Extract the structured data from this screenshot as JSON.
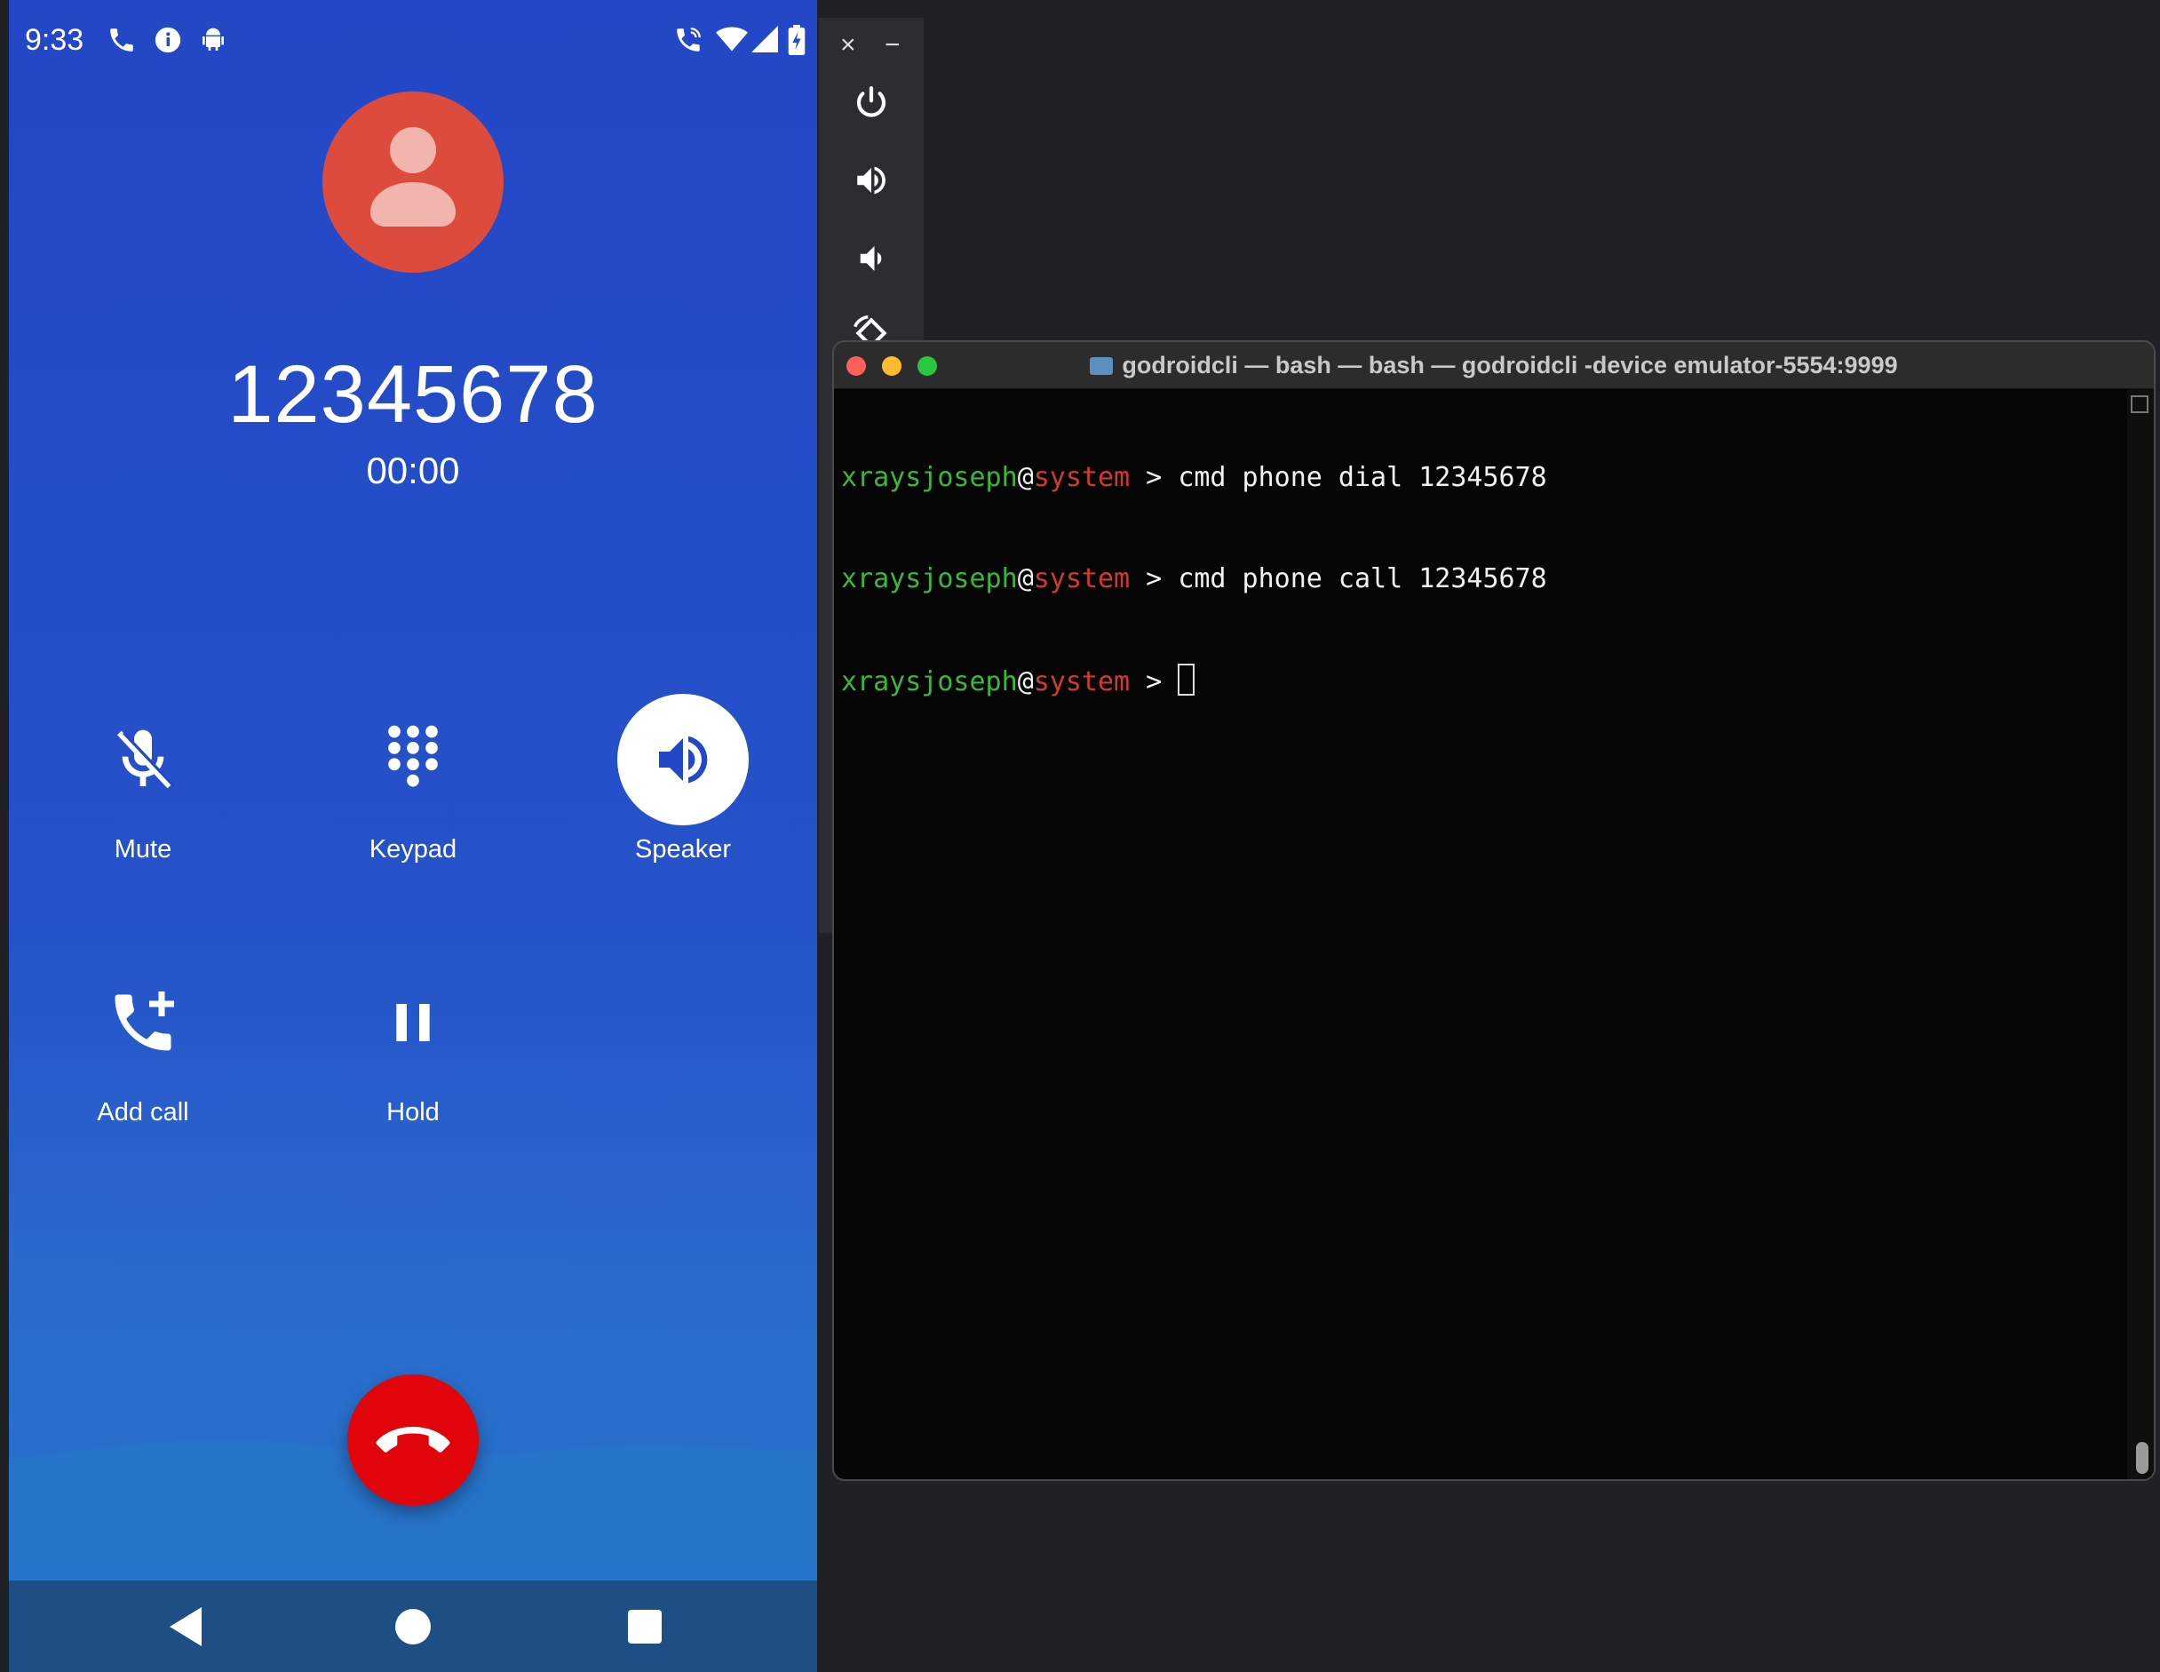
{
  "status_bar": {
    "time": "9:33",
    "left_icons": [
      "phone-call-icon",
      "info-icon",
      "android-icon"
    ],
    "right_icons": [
      "wifi-calling-icon",
      "wifi-icon",
      "cell-signal-icon",
      "battery-charging-icon"
    ]
  },
  "call": {
    "number": "12345678",
    "timer": "00:00"
  },
  "controls": {
    "mute": "Mute",
    "keypad": "Keypad",
    "speaker": "Speaker",
    "add_call": "Add call",
    "hold": "Hold"
  },
  "colors": {
    "avatar": "#dd4b3d",
    "end_call": "#e0040b",
    "phone_background": "#2347c6",
    "terminal_user": "#3bb83b",
    "terminal_host": "#d13a2d"
  },
  "toolbar": {
    "close": "×",
    "minimize": "−"
  },
  "terminal": {
    "title": "godroidcli — bash — bash — godroidcli -device emulator-5554:9999",
    "prompt": {
      "user": "xraysjoseph",
      "at": "@",
      "host": "system",
      "symbol": " > "
    },
    "lines": [
      "cmd phone dial 12345678",
      "cmd phone call 12345678",
      ""
    ]
  }
}
